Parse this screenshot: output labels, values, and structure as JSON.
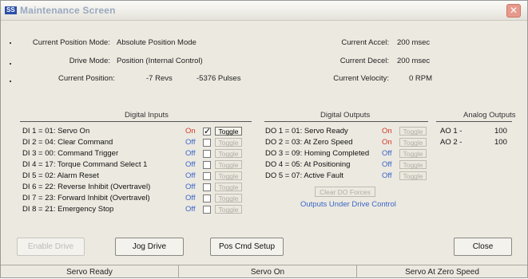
{
  "window": {
    "title": "Maintenance Screen",
    "icon": "SS",
    "close": "✕"
  },
  "info": {
    "mode_label": "Current Position Mode:",
    "mode_value": "Absolute Position Mode",
    "drive_label": "Drive Mode:",
    "drive_value": "Position (Internal Control)",
    "pos_label": "Current Position:",
    "pos_revs": "-7 Revs",
    "pos_pulses": "-5376 Pulses",
    "accel_label": "Current Accel:",
    "accel_value": "200 msec",
    "decel_label": "Current Decel:",
    "decel_value": "200 msec",
    "vel_label": "Current Velocity:",
    "vel_value": "0 RPM"
  },
  "digital_inputs": {
    "header": "Digital Inputs",
    "toggle_label": "Toggle",
    "rows": [
      {
        "label": "DI 1 = 01: Servo On",
        "state": "On",
        "checked": true
      },
      {
        "label": "DI 2 = 04: Clear Command",
        "state": "Off",
        "checked": false
      },
      {
        "label": "DI 3 = 00: Command Trigger",
        "state": "Off",
        "checked": false
      },
      {
        "label": "DI 4 = 17: Torque Command Select 1",
        "state": "Off",
        "checked": false
      },
      {
        "label": "DI 5 = 02: Alarm Reset",
        "state": "Off",
        "checked": false
      },
      {
        "label": "DI 6 = 22: Reverse Inhibit (Overtravel)",
        "state": "Off",
        "checked": false
      },
      {
        "label": "DI 7 = 23: Forward Inhibit (Overtravel)",
        "state": "Off",
        "checked": false
      },
      {
        "label": "DI 8 = 21: Emergency Stop",
        "state": "Off",
        "checked": false
      }
    ]
  },
  "digital_outputs": {
    "header": "Digital Outputs",
    "toggle_label": "Toggle",
    "rows": [
      {
        "label": "DO 1 = 01: Servo Ready",
        "state": "On"
      },
      {
        "label": "DO 2 = 03: At Zero Speed",
        "state": "On"
      },
      {
        "label": "DO 3 = 09: Homing Completed",
        "state": "Off"
      },
      {
        "label": "DO 4 = 05: At Positioning",
        "state": "Off"
      },
      {
        "label": "DO 5 = 07: Active Fault",
        "state": "Off"
      }
    ],
    "clear_button": "Clear DO Forces",
    "control_text": "Outputs Under Drive Control"
  },
  "analog_outputs": {
    "header": "Analog Outputs",
    "rows": [
      {
        "label": "AO 1 -",
        "value": "100"
      },
      {
        "label": "AO 2 -",
        "value": "100"
      }
    ]
  },
  "buttons": {
    "enable": "Enable Drive",
    "jog": "Jog Drive",
    "pos_cmd": "Pos Cmd Setup",
    "close": "Close"
  },
  "status": [
    "Servo Ready",
    "Servo On",
    "Servo At Zero Speed"
  ],
  "colors": {
    "on": "#d23a2a",
    "off": "#3a66c8"
  }
}
